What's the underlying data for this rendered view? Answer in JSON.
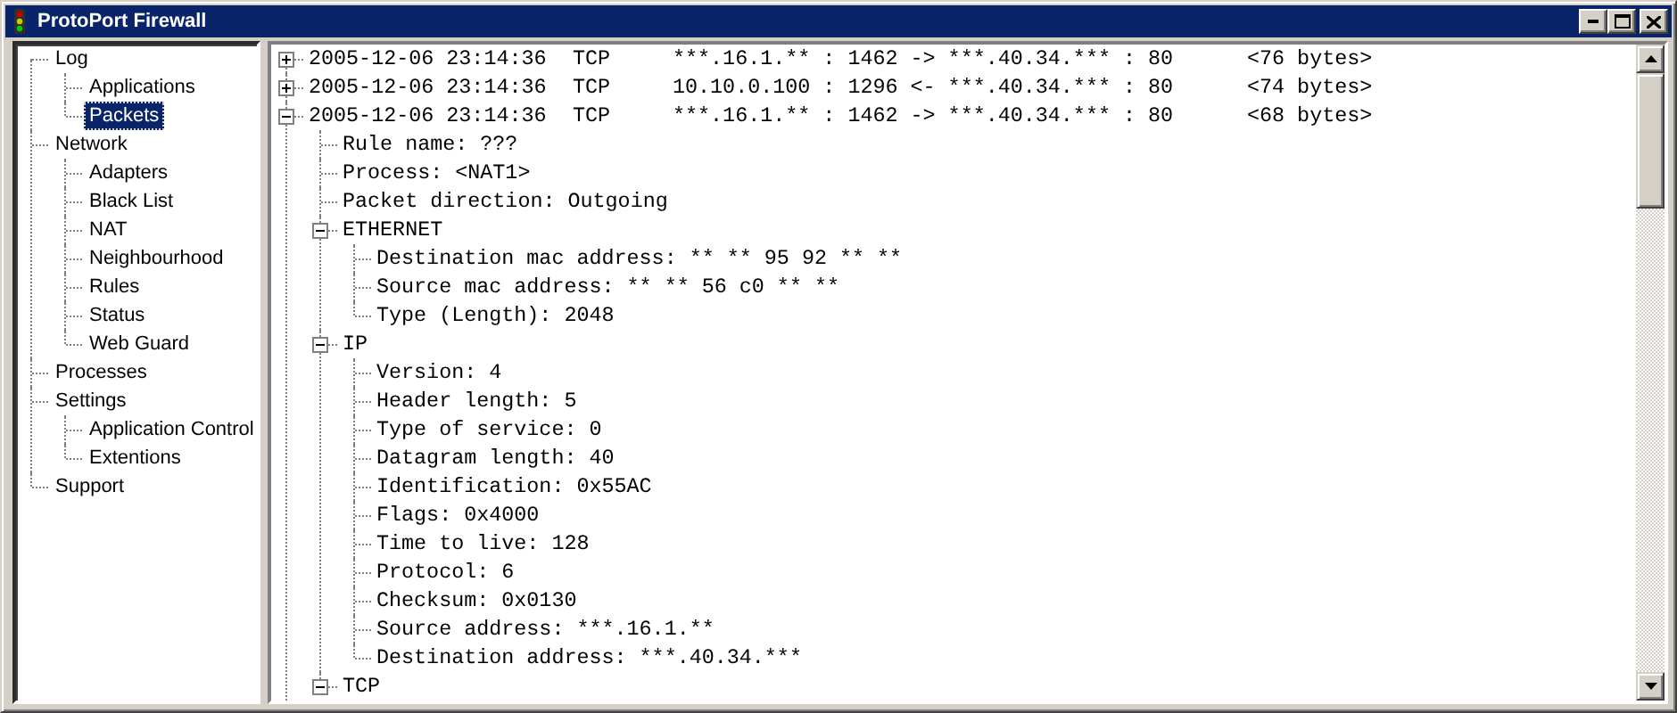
{
  "window": {
    "title": "ProtoPort Firewall"
  },
  "sidebar": {
    "items": [
      {
        "label": "Log",
        "selected": false,
        "children": [
          {
            "label": "Applications",
            "selected": false
          },
          {
            "label": "Packets",
            "selected": true
          }
        ]
      },
      {
        "label": "Network",
        "selected": false,
        "children": [
          {
            "label": "Adapters",
            "selected": false
          },
          {
            "label": "Black List",
            "selected": false
          },
          {
            "label": "NAT",
            "selected": false
          },
          {
            "label": "Neighbourhood",
            "selected": false
          },
          {
            "label": "Rules",
            "selected": false
          },
          {
            "label": "Status",
            "selected": false
          },
          {
            "label": "Web Guard",
            "selected": false
          }
        ]
      },
      {
        "label": "Processes",
        "selected": false
      },
      {
        "label": "Settings",
        "selected": false,
        "children": [
          {
            "label": "Application Control",
            "selected": false
          },
          {
            "label": "Extentions",
            "selected": false
          }
        ]
      },
      {
        "label": "Support",
        "selected": false
      }
    ]
  },
  "packets": [
    {
      "time": "2005-12-06 23:14:36",
      "protocol": "TCP",
      "route": "***.16.1.** : 1462 -> ***.40.34.*** : 80",
      "size": "<76 bytes>",
      "expanded": false
    },
    {
      "time": "2005-12-06 23:14:36",
      "protocol": "TCP",
      "route": "10.10.0.100 : 1296 <- ***.40.34.*** : 80",
      "size": "<74 bytes>",
      "expanded": false
    },
    {
      "time": "2005-12-06 23:14:36",
      "protocol": "TCP",
      "route": "***.16.1.** : 1462 -> ***.40.34.*** : 80",
      "size": "<68 bytes>",
      "expanded": true,
      "children": [
        {
          "label": "Rule name: ???"
        },
        {
          "label": "Process: <NAT1>"
        },
        {
          "label": "Packet direction: Outgoing"
        },
        {
          "label": "ETHERNET",
          "expanded": true,
          "children": [
            {
              "label": "Destination mac address: ** ** 95 92 ** **"
            },
            {
              "label": "Source mac address: ** ** 56 c0 ** **"
            },
            {
              "label": "Type (Length): 2048"
            }
          ]
        },
        {
          "label": "IP",
          "expanded": true,
          "children": [
            {
              "label": "Version: 4"
            },
            {
              "label": "Header length: 5"
            },
            {
              "label": "Type of service: 0"
            },
            {
              "label": "Datagram length: 40"
            },
            {
              "label": "Identification: 0x55AC"
            },
            {
              "label": "Flags: 0x4000"
            },
            {
              "label": "Time to live: 128"
            },
            {
              "label": "Protocol: 6"
            },
            {
              "label": "Checksum: 0x0130"
            },
            {
              "label": "Source address: ***.16.1.**"
            },
            {
              "label": "Destination address: ***.40.34.***"
            }
          ]
        },
        {
          "label": "TCP",
          "expanded": true
        }
      ]
    }
  ]
}
